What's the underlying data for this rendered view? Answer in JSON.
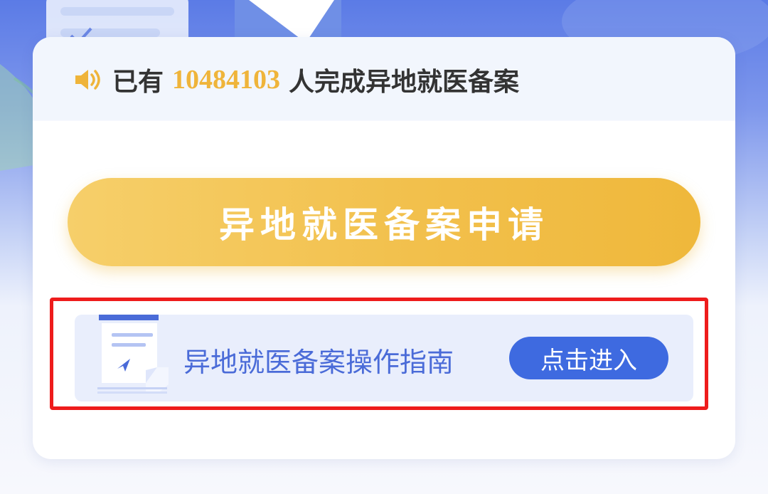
{
  "notice": {
    "prefix": "已有",
    "count": "10484103",
    "suffix": "人完成异地就医备案",
    "icon": "speaker-icon"
  },
  "apply_button": {
    "label": "异地就医备案申请"
  },
  "guide": {
    "label": "异地就医备案操作指南",
    "enter_label": "点击进入",
    "icon": "document-icon"
  },
  "colors": {
    "accent_gold": "#efb43a",
    "accent_blue": "#3e6ae0",
    "highlight_red": "#ee1c1c"
  }
}
